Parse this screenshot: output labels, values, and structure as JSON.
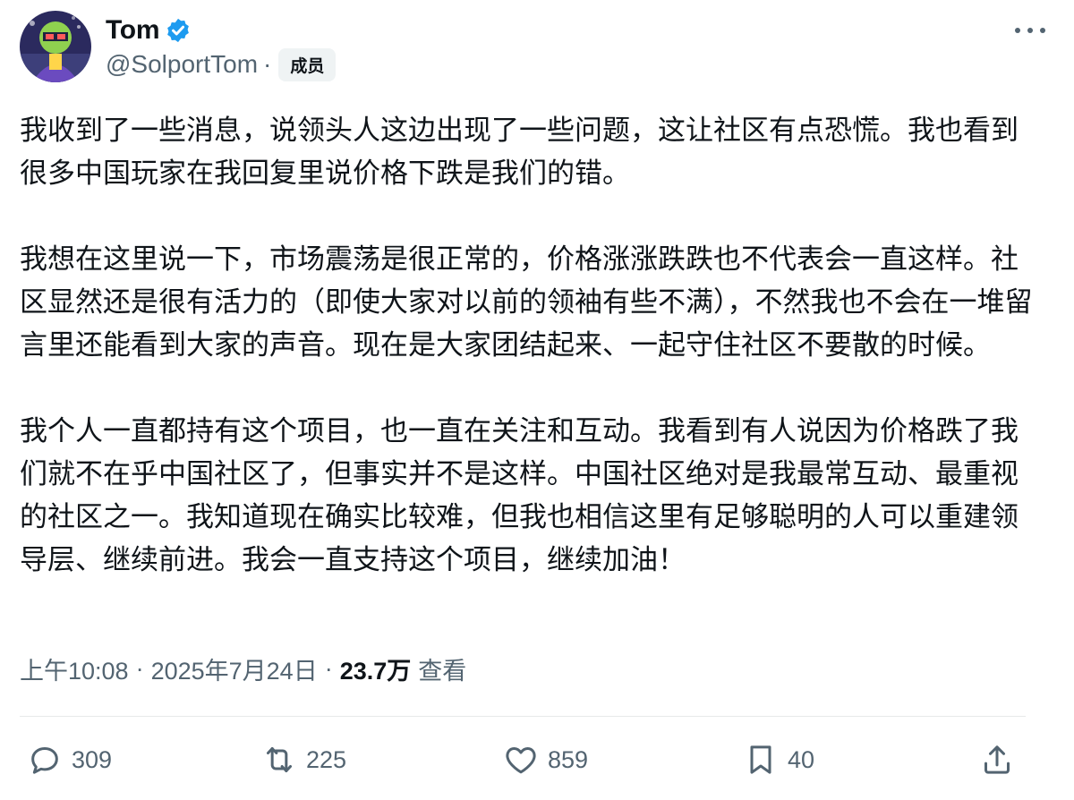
{
  "author": {
    "display_name": "Tom",
    "handle": "@SolportTom",
    "separator": "·",
    "badge": "成员",
    "verified_icon": "verified-badge-icon",
    "more_icon": "more-horizontal-icon"
  },
  "tweet": {
    "paragraphs": [
      "我收到了一些消息，说领头人这边出现了一些问题，这让社区有点恐慌。我也看到很多中国玩家在我回复里说价格下跌是我们的错。",
      "我想在这里说一下，市场震荡是很正常的，价格涨涨跌跌也不代表会一直这样。社区显然还是很有活力的（即使大家对以前的领袖有些不满），不然我也不会在一堆留言里还能看到大家的声音。现在是大家团结起来、一起守住社区不要散的时候。",
      "我个人一直都持有这个项目，也一直在关注和互动。我看到有人说因为价格跌了我们就不在乎中国社区了，但事实并不是这样。中国社区绝对是我最常互动、最重视的社区之一。我知道现在确实比较难，但我也相信这里有足够聪明的人可以重建领导层、继续前进。我会一直支持这个项目，继续加油！"
    ]
  },
  "meta": {
    "time": "上午10:08",
    "date": "2025年7月24日",
    "separator": "·",
    "views": "23.7万",
    "views_label": "查看"
  },
  "actions": {
    "reply_count": "309",
    "retweet_count": "225",
    "like_count": "859",
    "bookmark_count": "40"
  },
  "colors": {
    "text_primary": "#0f1419",
    "text_secondary": "#536471",
    "verified_blue": "#1d9bf0",
    "badge_bg": "#eff3f4",
    "divider": "#e7e9ea"
  }
}
